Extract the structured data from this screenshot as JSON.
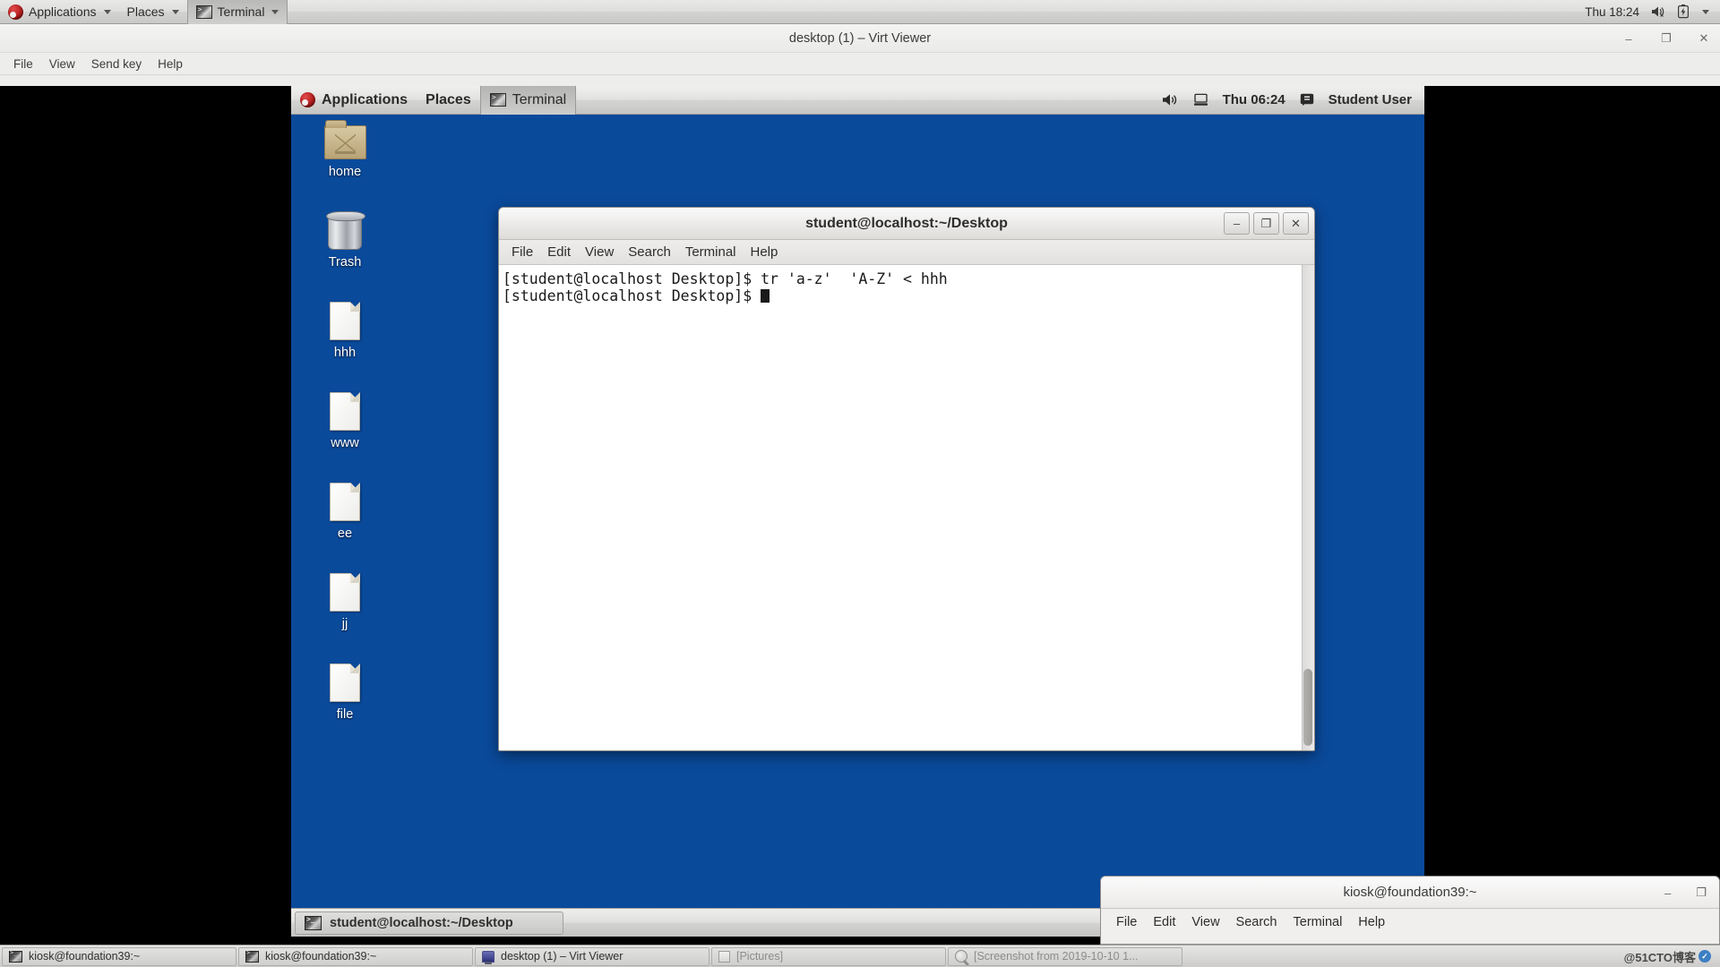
{
  "host_panel": {
    "logo_icon": "fedora-logo-icon",
    "menus": [
      {
        "label": "Applications",
        "icon": "fedora-logo-icon",
        "has_caret": true,
        "active": false
      },
      {
        "label": "Places",
        "icon": "",
        "has_caret": true,
        "active": false
      },
      {
        "label": "Terminal",
        "icon": "terminal-icon",
        "has_caret": true,
        "active": true
      }
    ],
    "clock": "Thu 18:24",
    "tray": [
      "volume-muted-icon",
      "battery-charging-icon",
      "chevron-down-icon"
    ]
  },
  "virt_viewer": {
    "title": "desktop (1) – Virt Viewer",
    "window_buttons": {
      "minimize": "–",
      "maximize": "❐",
      "close": "✕"
    },
    "menus": [
      "File",
      "View",
      "Send key",
      "Help"
    ]
  },
  "vm_panel": {
    "menus": [
      {
        "label": "Applications",
        "icon": "fedora-logo-icon",
        "active": false
      },
      {
        "label": "Places",
        "icon": "",
        "active": false
      },
      {
        "label": "Terminal",
        "icon": "terminal-icon",
        "active": true
      }
    ],
    "tray": {
      "volume_icon": "volume-icon",
      "network_icon": "network-icon",
      "clock": "Thu 06:24",
      "user_icon": "user-switch-icon",
      "user": "Student User"
    }
  },
  "desktop_icons": [
    {
      "label": "home",
      "type": "folder"
    },
    {
      "label": "Trash",
      "type": "trash"
    },
    {
      "label": "hhh",
      "type": "file"
    },
    {
      "label": "www",
      "type": "file"
    },
    {
      "label": "ee",
      "type": "file"
    },
    {
      "label": "jj",
      "type": "file"
    },
    {
      "label": "file",
      "type": "file"
    }
  ],
  "gnome_terminal": {
    "title": "student@localhost:~/Desktop",
    "window_buttons": {
      "minimize": "–",
      "maximize": "❐",
      "close": "✕"
    },
    "menus": [
      "File",
      "Edit",
      "View",
      "Search",
      "Terminal",
      "Help"
    ],
    "lines": [
      "[student@localhost Desktop]$ tr 'a-z'  'A-Z' < hhh",
      "[student@localhost Desktop]$ "
    ],
    "prompt": "[student@localhost Desktop]$ ",
    "command": "tr 'a-z'  'A-Z' < hhh"
  },
  "vm_taskbar": {
    "buttons": [
      {
        "label": "student@localhost:~/Desktop",
        "icon": "terminal-icon",
        "active": true
      }
    ]
  },
  "background_terminal": {
    "title": "kiosk@foundation39:~",
    "window_buttons": {
      "minimize": "–",
      "maximize": "❐"
    },
    "menus": [
      "File",
      "Edit",
      "View",
      "Search",
      "Terminal",
      "Help"
    ]
  },
  "host_taskbar": {
    "buttons": [
      {
        "label": "kiosk@foundation39:~",
        "icon": "terminal-icon",
        "dim": false
      },
      {
        "label": "kiosk@foundation39:~",
        "icon": "terminal-icon",
        "dim": false
      },
      {
        "label": "desktop (1) – Virt Viewer",
        "icon": "virt-viewer-icon",
        "dim": false
      },
      {
        "label": "[Pictures]",
        "icon": "pictures-icon",
        "dim": true
      },
      {
        "label": "[Screenshot from 2019-10-10 1...",
        "icon": "screenshot-icon",
        "dim": true
      }
    ],
    "watermark": "@51CTO博客"
  }
}
